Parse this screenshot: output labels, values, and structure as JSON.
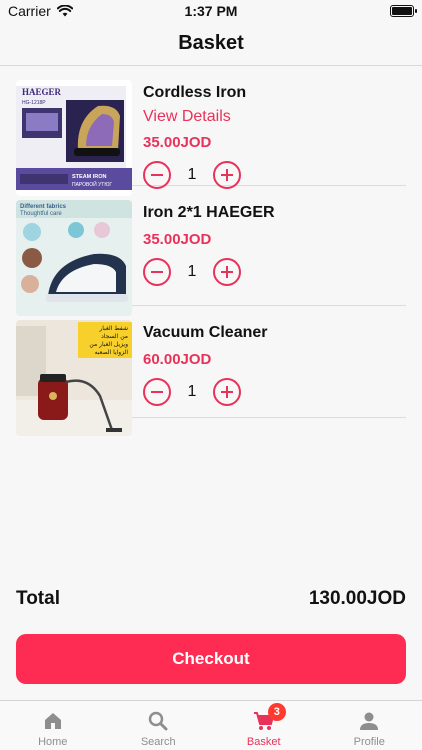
{
  "status_bar": {
    "carrier": "Carrier",
    "time": "1:37 PM"
  },
  "header": {
    "title": "Basket"
  },
  "items": [
    {
      "name": "Cordless Iron",
      "details_label": "View Details",
      "price": "35.00JOD",
      "quantity": "1",
      "image_text": {
        "brand": "HAEGER",
        "model": "HG-1218P",
        "steam": "STEAM IRON",
        "ru": "ПАРОВОЙ УТЮГ"
      }
    },
    {
      "name": "Iron 2*1 HAEGER",
      "price": "35.00JOD",
      "quantity": "1",
      "image_text": {
        "line1": "Different fabrics",
        "line2": "Thoughtful care"
      }
    },
    {
      "name": "Vacuum Cleaner",
      "price": "60.00JOD",
      "quantity": "1",
      "image_text": {
        "line1": "شفط الغبار",
        "line2": "من السجاد",
        "line3": "ويزيل الغبار من",
        "line4": "الزوايا الصعبه"
      }
    }
  ],
  "summary": {
    "total_label": "Total",
    "total_value": "130.00JOD"
  },
  "checkout_label": "Checkout",
  "tabs": [
    {
      "label": "Home",
      "icon": "home-icon"
    },
    {
      "label": "Search",
      "icon": "search-icon"
    },
    {
      "label": "Basket",
      "icon": "cart-icon",
      "badge": "3",
      "active": true
    },
    {
      "label": "Profile",
      "icon": "person-icon"
    }
  ],
  "colors": {
    "accent": "#e8325a",
    "button": "#fe2b52",
    "badge": "#ff3b30"
  }
}
